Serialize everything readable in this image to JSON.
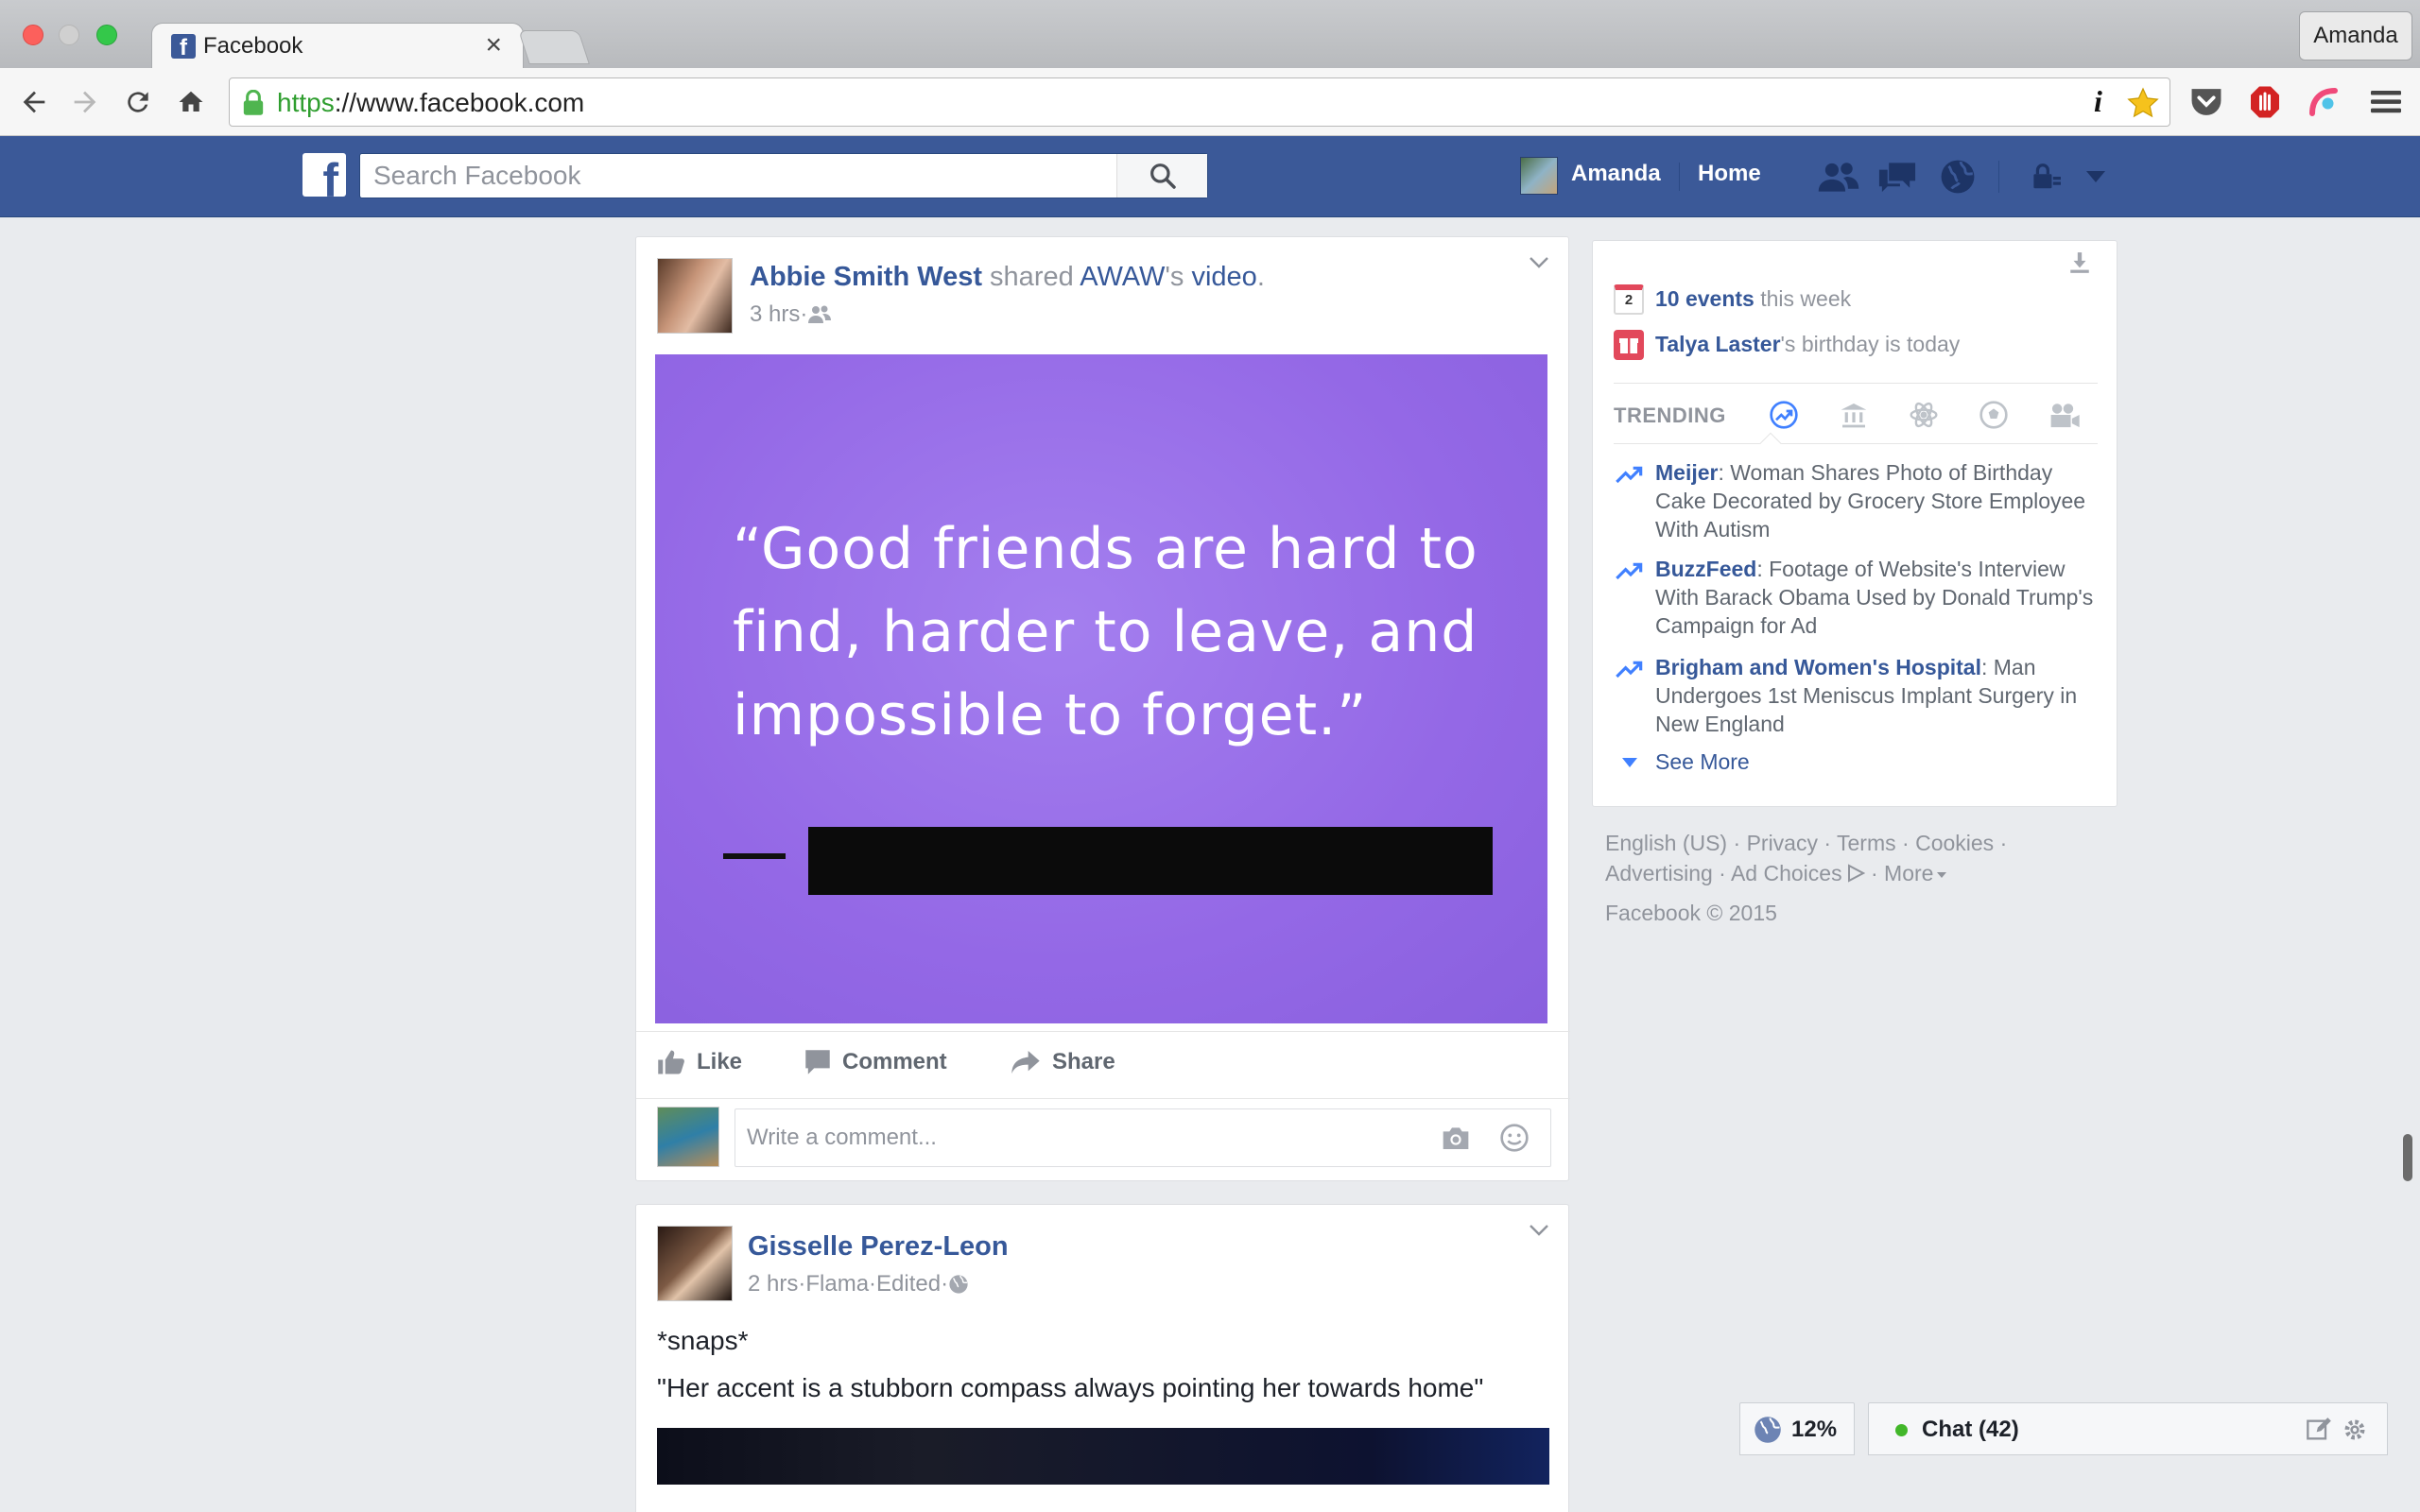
{
  "browser": {
    "tab_title": "Facebook",
    "tab_close": "×",
    "profile_name": "Amanda",
    "url_protocol": "https",
    "url_rest": "://www.facebook.com",
    "info_glyph": "i"
  },
  "header": {
    "logo": "f",
    "search_placeholder": "Search Facebook",
    "user_name": "Amanda",
    "home_label": "Home"
  },
  "post1": {
    "author": "Abbie Smith West",
    "verb": " shared ",
    "page": "AWAW",
    "suffix": "'s ",
    "object": "video",
    "period": ".",
    "time": "3 hrs",
    "dot": " · ",
    "quote": "“Good friends are hard to find, harder to leave, and impossible to forget.”",
    "actions": {
      "like": "Like",
      "comment": "Comment",
      "share": "Share"
    },
    "comment_placeholder": "Write a comment..."
  },
  "post2": {
    "author": "Gisselle Perez-Leon",
    "time": "2 hrs",
    "dot": " · ",
    "location": "Flama",
    "edited": "Edited",
    "line1": "*snaps*",
    "line2": "\"Her accent is a stubborn compass always pointing her towards home\""
  },
  "rightcol": {
    "calendar_day": "2",
    "events_count": "10 events",
    "events_suffix": " this week",
    "birthday_name": "Talya Laster",
    "birthday_suffix": "'s birthday is today",
    "trending_label": "TRENDING",
    "trends": [
      {
        "source": "Meijer",
        "text": ": Woman Shares Photo of Birthday Cake Decorated by Grocery Store Employee With Autism"
      },
      {
        "source": "BuzzFeed",
        "text": ": Footage of Website's Interview With Barack Obama Used by Donald Trump's Campaign for Ad"
      },
      {
        "source": "Brigham and Women's Hospital",
        "text": ": Man Undergoes 1st Meniscus Implant Surgery in New England"
      }
    ],
    "see_more": "See More"
  },
  "footer": {
    "english": "English (US)",
    "privacy": "Privacy",
    "terms": "Terms",
    "cookies": "Cookies",
    "advertising": "Advertising",
    "ad_choices": "Ad Choices",
    "more": "More",
    "sep": " · ",
    "copyright": "Facebook © 2015"
  },
  "bottom": {
    "percent": "12%",
    "chat": "Chat (42)"
  },
  "colors": {
    "facebook_blue": "#3b5998",
    "link_blue": "#365899",
    "quote_purple": "#9468e6",
    "chat_online": "#42b72a"
  }
}
